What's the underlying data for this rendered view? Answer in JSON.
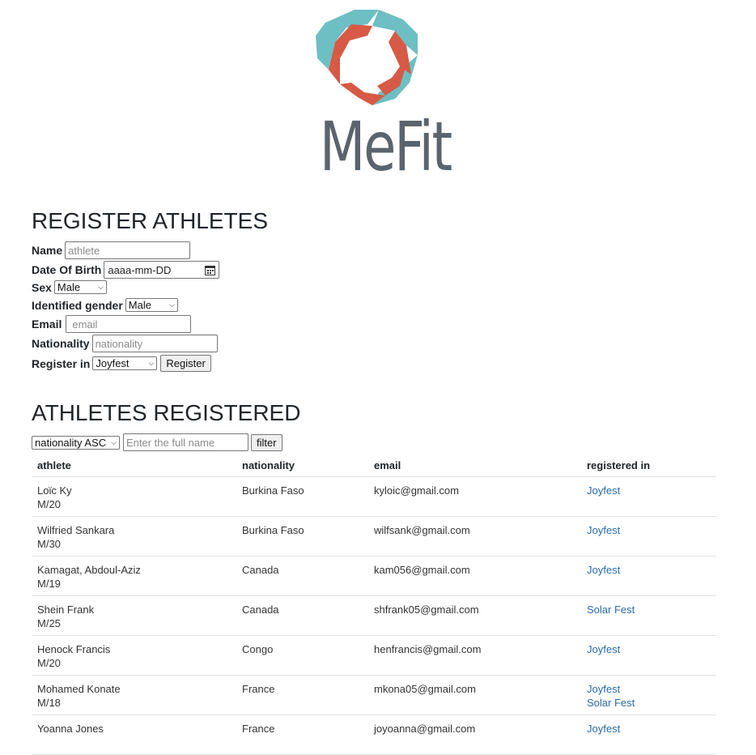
{
  "logo": {
    "text": "MeFit",
    "colors": {
      "teal": "#6dbfc4",
      "red": "#d65a45",
      "text": "#5b646c"
    }
  },
  "register_section": {
    "title": "REGISTER ATHLETES",
    "name": {
      "label": "Name",
      "placeholder": "athlete"
    },
    "dob": {
      "label": "Date Of Birth",
      "placeholder": "aaaa-mm-DD",
      "icon": "calendar-icon"
    },
    "sex": {
      "label": "Sex",
      "value": "Male"
    },
    "identified_gender": {
      "label": "Identified gender",
      "value": "Male"
    },
    "email": {
      "label": "Email",
      "placeholder": "email"
    },
    "nationality": {
      "label": "Nationality",
      "placeholder": "nationality"
    },
    "register_in": {
      "label": "Register in",
      "value": "Joyfest"
    },
    "register_button": "Register"
  },
  "registered_section": {
    "title": "ATHLETES REGISTERED",
    "sort": {
      "value": "nationality ASC"
    },
    "search": {
      "placeholder": "Enter the full name"
    },
    "filter_button": "filter",
    "columns": [
      "athlete",
      "nationality",
      "email",
      "registered in"
    ],
    "rows": [
      {
        "name": "Loϊc Ky",
        "info": "M/20",
        "nationality": "Burkina Faso",
        "email": "kyloic@gmail.com",
        "events": [
          "Joyfest"
        ]
      },
      {
        "name": "Wilfried Sankara",
        "info": "M/30",
        "nationality": "Burkina Faso",
        "email": "wilfsank@gmail.com",
        "events": [
          "Joyfest"
        ]
      },
      {
        "name": "Kamagat, Abdoul-Aziz",
        "info": "M/19",
        "nationality": "Canada",
        "email": "kam056@gmail.com",
        "events": [
          "Joyfest"
        ]
      },
      {
        "name": "Shein Frank",
        "info": "M/25",
        "nationality": "Canada",
        "email": "shfrank05@gmail.com",
        "events": [
          "Solar Fest"
        ]
      },
      {
        "name": "Henock Francis",
        "info": "M/20",
        "nationality": "Congo",
        "email": "henfrancis@gmail.com",
        "events": [
          "Joyfest"
        ]
      },
      {
        "name": "Mohamed Konate",
        "info": "M/18",
        "nationality": "France",
        "email": "mkona05@gmail.com",
        "events": [
          "Joyfest",
          "Solar Fest"
        ]
      },
      {
        "name": "Yoanna Jones",
        "info": "",
        "nationality": "France",
        "email": "joyoanna@gmail.com",
        "events": [
          "Joyfest"
        ]
      }
    ]
  }
}
